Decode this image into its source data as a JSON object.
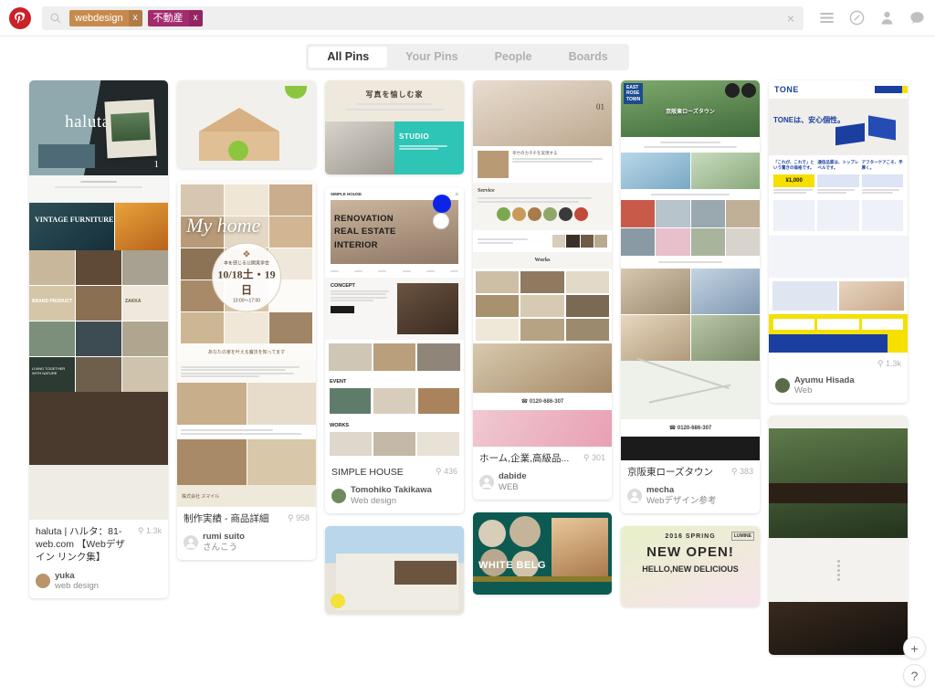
{
  "header": {
    "logo_name": "pinterest-logo",
    "search": {
      "placeholder": "",
      "icon": "search-icon",
      "clear_label": "×",
      "tags": [
        {
          "label": "webdesign",
          "color": "#c78a4e",
          "remove_label": "x"
        },
        {
          "label": "不動産",
          "color": "#a42a6e",
          "remove_label": "x"
        }
      ]
    },
    "icons": [
      {
        "name": "hamburger-menu-icon",
        "title": "Menu"
      },
      {
        "name": "compass-explore-icon",
        "title": "Explore"
      },
      {
        "name": "profile-person-icon",
        "title": "Profile"
      },
      {
        "name": "messages-chat-icon",
        "title": "Messages"
      }
    ]
  },
  "tabs": [
    {
      "label": "All Pins",
      "active": true
    },
    {
      "label": "Your Pins",
      "active": false
    },
    {
      "label": "People",
      "active": false
    },
    {
      "label": "Boards",
      "active": false
    }
  ],
  "fab": {
    "add_label": "+",
    "help_label": "?"
  },
  "pins": [
    {
      "id": "haluta",
      "title": "haluta | ハルタ：81-web.com 【Webデザイン リンク集】",
      "repins": "1.3k",
      "user": "yuka",
      "board": "web design",
      "hero_text": "haluta",
      "hero_number": "1",
      "section_label": "VINTAGE FURNITURE",
      "tag_label": "BRAND PRODUCT",
      "tag_label2": "ZAKKA",
      "tag_label3": "LIVING TOGETHER WITH NATURE"
    },
    {
      "id": "myhome",
      "title": "制作実績 - 商品詳細",
      "repins": "958",
      "user": "rumi suito",
      "board": "さんこう",
      "hero_text": "My home",
      "badge_line1": "本を感じる公開見学会",
      "badge_date": "10/18土・19日",
      "badge_time": "10:00〜17:00",
      "footer_text": "あなたの家を叶える魔法を知ってます",
      "company": "株式会社 スマイル"
    },
    {
      "id": "simplehouse",
      "title": "SIMPLE HOUSE",
      "repins": "436",
      "user": "Tomohiko Takikawa",
      "board": "Web design",
      "brand": "SIMPLE HOUSE",
      "headline_lines": [
        "RENOVATION",
        "REAL ESTATE",
        "INTERIOR"
      ],
      "section_concept": "CONCEPT",
      "section_event": "EVENT",
      "section_works": "WORKS"
    },
    {
      "id": "architecture",
      "title": "ホーム,企業,高級品...",
      "repins": "301",
      "user": "dabide",
      "board": "WEB",
      "hero_number": "01",
      "section_service": "Service",
      "section_works": "Works",
      "tagline": "幸せのカタチを実現する",
      "phone": "0120-686-307"
    },
    {
      "id": "eastrosetown",
      "title": "京阪東ローズタウン",
      "repins": "383",
      "user": "mecha",
      "board": "Webデザイン参考",
      "logo_lines": [
        "EAST",
        "ROSE",
        "TOWN"
      ],
      "hero_text": "京阪東ローズタウン"
    },
    {
      "id": "tone",
      "title": "",
      "repins": "1.3k",
      "user": "Ayumu Hisada",
      "board": "Web",
      "brand": "TONE",
      "headline": "TONEは、安心個性。",
      "price": "¥1,000",
      "col1": "「これが、これで」という驚きの価格です。",
      "col2": "通信品質は、トップレベルです。",
      "col3": "アフターケアこそ、手厚く。"
    },
    {
      "id": "woodhouse",
      "title": "",
      "repins": "",
      "user": "",
      "board": ""
    },
    {
      "id": "photohouse",
      "title": "",
      "repins": "",
      "user": "",
      "board": "",
      "headline": "写真を愉しむ家",
      "studio_label": "STUDIO"
    },
    {
      "id": "building",
      "title": "",
      "repins": "",
      "user": "",
      "board": ""
    },
    {
      "id": "whitebelg",
      "title": "",
      "repins": "",
      "user": "",
      "board": "",
      "brand": "WHITE BELG"
    },
    {
      "id": "lumine",
      "title": "",
      "repins": "",
      "user": "",
      "board": "",
      "year": "2016 SPRING",
      "headline": "NEW OPEN!",
      "subhead": "HELLO,NEW DELICIOUS",
      "brand": "LUMINE"
    },
    {
      "id": "temple",
      "title": "",
      "repins": "",
      "user": "",
      "board": ""
    }
  ]
}
